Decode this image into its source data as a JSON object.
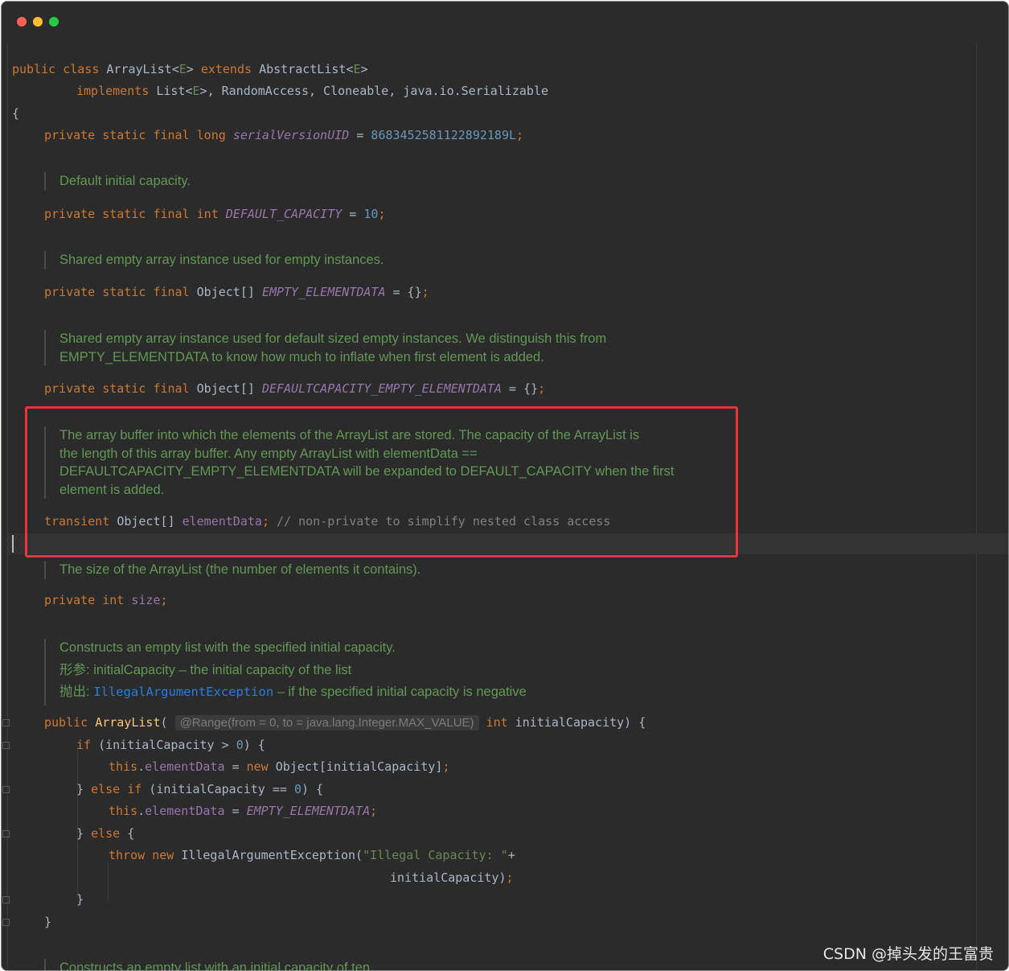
{
  "window": {
    "buttons": {
      "close": "close",
      "minimize": "minimize",
      "zoom": "zoom"
    }
  },
  "code": {
    "class_decl_1": {
      "public": "public",
      "class": "class",
      "name": "ArrayList",
      "lt": "<",
      "E": "E",
      "gt": ">",
      "extends": "extends",
      "super": "AbstractList"
    },
    "class_decl_2": {
      "implements": "implements",
      "list": "List",
      "rest": ", RandomAccess, Cloneable, java.io.Serializable"
    },
    "open_brace": "{",
    "serial": {
      "mods": "private static final long",
      "name": "serialVersionUID",
      "eq": " = ",
      "value": "8683452581122892189L",
      "semi": ";"
    },
    "doc_default_capacity": "Default initial capacity.",
    "default_capacity": {
      "mods": "private static final int",
      "name": "DEFAULT_CAPACITY",
      "eq": " = ",
      "value": "10",
      "semi": ";"
    },
    "doc_empty": "Shared empty array instance used for empty instances.",
    "empty": {
      "mods": "private static final",
      "type": "Object[]",
      "name": "EMPTY_ELEMENTDATA",
      "rest": " = {}",
      "semi": ";"
    },
    "doc_default_empty_1": "Shared empty array instance used for default sized empty instances. We distinguish this from",
    "doc_default_empty_2": "EMPTY_ELEMENTDATA to know how much to inflate when first element is added.",
    "default_empty": {
      "mods": "private static final",
      "type": "Object[]",
      "name": "DEFAULTCAPACITY_EMPTY_ELEMENTDATA",
      "rest": " = {}",
      "semi": ";"
    },
    "doc_buffer_1": "The array buffer into which the elements of the ArrayList are stored. The capacity of the ArrayList is",
    "doc_buffer_2": "the length of this array buffer. Any empty ArrayList with elementData ==",
    "doc_buffer_3": "DEFAULTCAPACITY_EMPTY_ELEMENTDATA will be expanded to DEFAULT_CAPACITY when the first",
    "doc_buffer_4": "element is added.",
    "element_data": {
      "mod": "transient",
      "type": "Object[]",
      "name": "elementData",
      "semi": ";",
      "comment": "// non-private to simplify nested class access"
    },
    "doc_size": "The size of the ArrayList (the number of elements it contains).",
    "size": {
      "mods": "private int",
      "name": "size",
      "semi": ";"
    },
    "doc_ctor_1": "Constructs an empty list with the specified initial capacity.",
    "doc_ctor_param_label": "形参:",
    "doc_ctor_param": "initialCapacity – the initial capacity of the list",
    "doc_ctor_throws_label": "抛出:",
    "doc_ctor_throws_link": "IllegalArgumentException",
    "doc_ctor_throws": "– if the specified initial capacity is negative",
    "ctor": {
      "public": "public",
      "name": "ArrayList",
      "open": "(",
      "hint": "@Range(from = 0, to = java.lang.Integer.MAX_VALUE)",
      "int": "int",
      "param": "initialCapacity) {"
    },
    "if_line": {
      "if": "if",
      "cond": " (initialCapacity > ",
      "zero": "0",
      "close": ") {"
    },
    "assign1": {
      "this": "this",
      "dot": ".",
      "field": "elementData",
      "eq": " = ",
      "new": "new",
      "rest": " Object[initialCapacity]",
      "semi": ";"
    },
    "elseif_line": {
      "brace": "} ",
      "else": "else",
      "if": "if",
      "cond": " (initialCapacity == ",
      "zero": "0",
      "close": ") {"
    },
    "assign2": {
      "this": "this",
      "dot": ".",
      "field": "elementData",
      "eq": " = ",
      "const": "EMPTY_ELEMENTDATA",
      "semi": ";"
    },
    "else_line": {
      "brace": "} ",
      "else": "else",
      "open": " {"
    },
    "throw_line": {
      "throw": "throw",
      "new": "new",
      "cls": " IllegalArgumentException(",
      "str": "\"Illegal Capacity: \"",
      "plus": "+"
    },
    "throw_cont": {
      "arg": "initialCapacity)",
      "semi": ";"
    },
    "close_inner": "}",
    "close_method": "}",
    "doc_next": "Constructs an empty list with an initial capacity of ten."
  },
  "watermark": "CSDN @掉头发的王富贵",
  "colors": {
    "highlight_box": "#e8343b",
    "background": "#2b2b2b"
  }
}
